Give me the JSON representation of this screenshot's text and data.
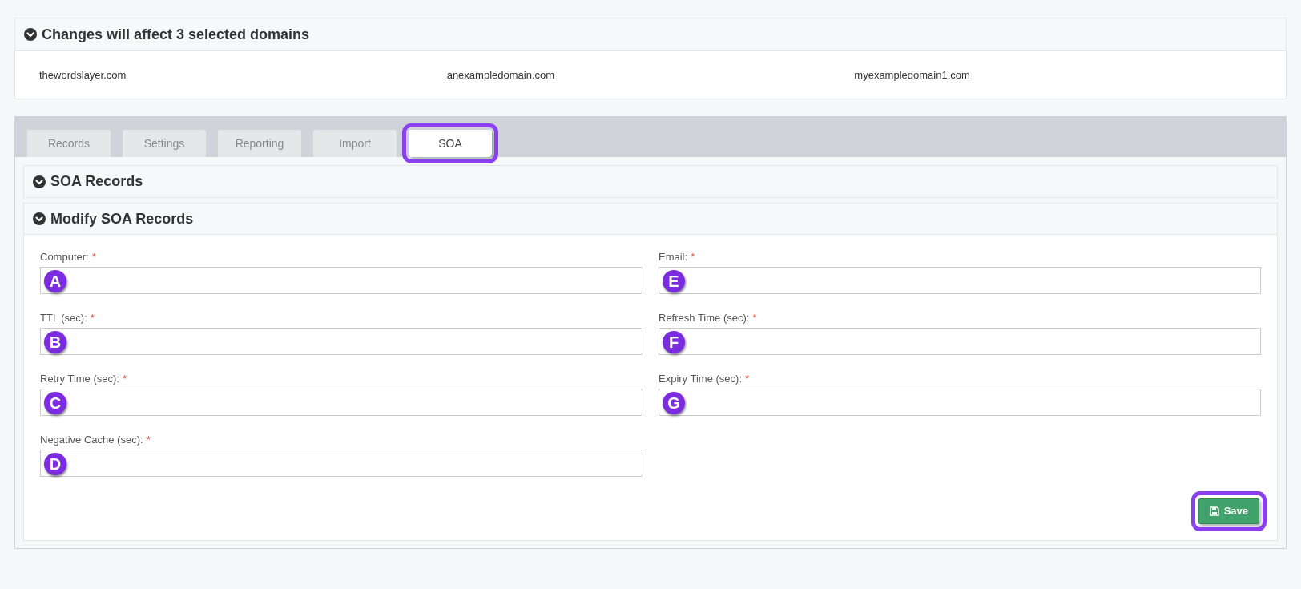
{
  "domains_panel": {
    "title": "Changes will affect 3 selected domains",
    "expanded": true,
    "domains": [
      "thewordslayer.com",
      "anexampledomain.com",
      "myexampledomain1.com"
    ]
  },
  "tabs": [
    {
      "label": "Records",
      "selected": false,
      "highlighted": false
    },
    {
      "label": "Settings",
      "selected": false,
      "highlighted": false
    },
    {
      "label": "Reporting",
      "selected": false,
      "highlighted": false
    },
    {
      "label": "Import",
      "selected": false,
      "highlighted": false
    },
    {
      "label": "SOA",
      "selected": true,
      "highlighted": true
    }
  ],
  "soa_records": {
    "title": "SOA Records",
    "expanded": true
  },
  "modify_panel": {
    "title": "Modify SOA Records",
    "expanded": true,
    "columns": [
      [
        {
          "label": "Computer:",
          "required": "*",
          "badge": "A"
        },
        {
          "label": "TTL (sec):",
          "required": "*",
          "badge": "B"
        },
        {
          "label": "Retry Time (sec):",
          "required": "*",
          "badge": "C"
        },
        {
          "label": "Negative Cache (sec):",
          "required": "*",
          "badge": "D"
        }
      ],
      [
        {
          "label": "Email:",
          "required": "*",
          "badge": "E"
        },
        {
          "label": "Refresh Time (sec):",
          "required": "*",
          "badge": "F"
        },
        {
          "label": "Expiry Time (sec):",
          "required": "*",
          "badge": "G"
        }
      ]
    ],
    "save_button": {
      "label": "Save",
      "highlighted": true
    }
  }
}
